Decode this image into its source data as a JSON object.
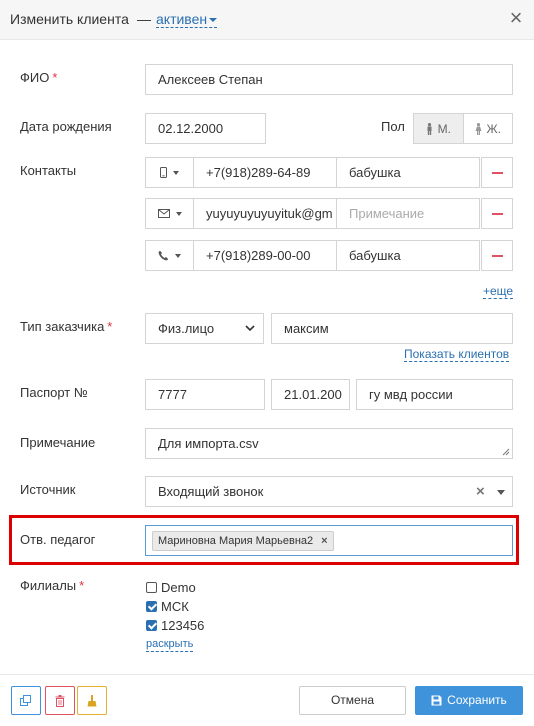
{
  "header": {
    "title": "Изменить клиента",
    "dash": "—",
    "status": "активен",
    "close": "×"
  },
  "fio": {
    "label": "ФИО",
    "required": "*",
    "value": "Алексеев Степан"
  },
  "birth": {
    "label": "Дата рождения",
    "value": "02.12.2000"
  },
  "gender": {
    "label": "Пол",
    "male": "М.",
    "female": "Ж."
  },
  "contacts": {
    "label": "Контакты",
    "rows": [
      {
        "value": "+7(918)289-64-89",
        "note": "бабушка",
        "note_placeholder": ""
      },
      {
        "value": "yuyuyuyuyuyituk@gm",
        "note": "",
        "note_placeholder": "Примечание"
      },
      {
        "value": "+7(918)289-00-00",
        "note": "бабушка",
        "note_placeholder": ""
      }
    ],
    "more": "+еще"
  },
  "customer_type": {
    "label": "Тип заказчика",
    "required": "*",
    "selected": "Физ.лицо",
    "value": "максим",
    "show_clients": "Показать клиентов"
  },
  "passport": {
    "label": "Паспорт №",
    "number": "7777",
    "date": "21.01.200",
    "issued": "гу мвд россии"
  },
  "note": {
    "label": "Примечание",
    "value": "Для импорта.csv"
  },
  "source": {
    "label": "Источник",
    "selected": "Входящий звонок",
    "clear": "×"
  },
  "teacher": {
    "label": "Отв. педагог",
    "tag": "Мариновна Мария Марьевна2",
    "tag_remove": "×"
  },
  "branches": {
    "label": "Филиалы",
    "required": "*",
    "items": [
      {
        "label": "Demo",
        "checked": false
      },
      {
        "label": "МСК",
        "checked": true
      },
      {
        "label": "123456",
        "checked": true
      }
    ],
    "expand": "раскрыть"
  },
  "footer": {
    "cancel": "Отмена",
    "save": "Сохранить"
  },
  "colors": {
    "accent": "#2a6fb0",
    "save": "#3f93da",
    "highlight": "#dd0000",
    "danger": "#e05263"
  }
}
